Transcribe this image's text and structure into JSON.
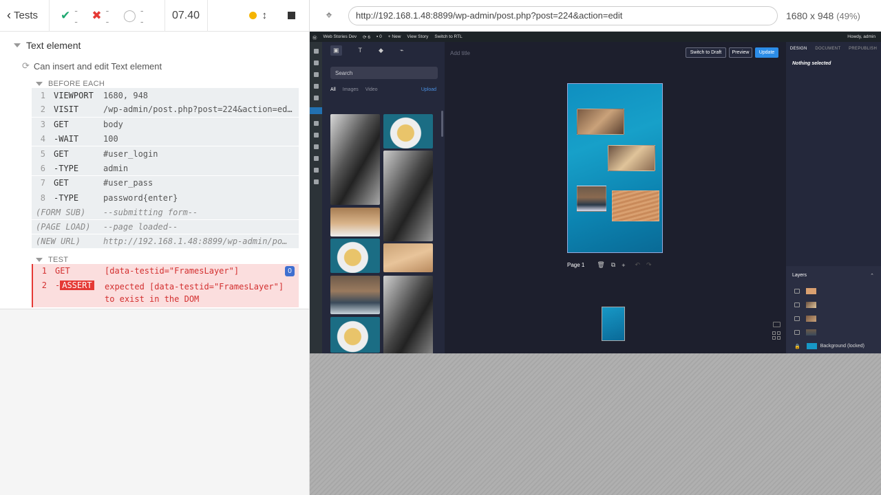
{
  "reporter": {
    "tests_label": "Tests",
    "passed": "--",
    "failed": "--",
    "pending": "--",
    "duration": "07.40",
    "suite_title": "Text element",
    "test_title": "Can insert and edit Text element",
    "before_each_label": "BEFORE EACH",
    "test_label": "TEST",
    "before_each": [
      {
        "num": "1",
        "name": "VIEWPORT",
        "msg": "1680, 948"
      },
      {
        "num": "2",
        "name": "VISIT",
        "msg": "/wp-admin/post.php?post=224&action=edit -> …"
      },
      {
        "num": "3",
        "name": "GET",
        "msg": "body"
      },
      {
        "num": "4",
        "name": "-WAIT",
        "msg": "100"
      },
      {
        "num": "5",
        "name": "GET",
        "msg": "#user_login"
      },
      {
        "num": "6",
        "name": "-TYPE",
        "msg": "admin"
      },
      {
        "num": "7",
        "name": "GET",
        "msg": "#user_pass"
      },
      {
        "num": "8",
        "name": "-TYPE",
        "msg": "password{enter}"
      }
    ],
    "events": [
      {
        "name": "(FORM SUB)",
        "msg": "--submitting form--"
      },
      {
        "name": "(PAGE LOAD)",
        "msg": "--page loaded--"
      },
      {
        "name": "(NEW URL)",
        "msg": "http://192.168.1.48:8899/wp-admin/po…"
      }
    ],
    "test_cmds": {
      "c1_num": "1",
      "c1_name": "GET",
      "c1_msg": "[data-testid=\"FramesLayer\"]",
      "c1_badge": "0",
      "c2_num": "2",
      "c2_name_prefix": "-",
      "c2_name": "ASSERT",
      "c2_msg_line1": "expected [data-testid=\"FramesLayer\"]",
      "c2_msg_line2": "to exist in the DOM"
    }
  },
  "aut": {
    "url": "http://192.168.1.48:8899/wp-admin/post.php?post=224&action=edit",
    "viewport_size": "1680 x 948",
    "viewport_scale": "(49%)"
  },
  "wp": {
    "site_name": "Web Stories Dev",
    "updates": "6",
    "comments": "0",
    "new_label": "+ New",
    "view_story": "View Story",
    "switch_rtl": "Switch to RTL",
    "howdy": "Howdy, admin",
    "search_placeholder": "Search",
    "filter_all": "All",
    "filter_images": "Images",
    "filter_video": "Video",
    "upload": "Upload",
    "add_title": "Add title",
    "switch_draft": "Switch to Draft",
    "preview": "Preview",
    "update": "Update",
    "page_label": "Page 1",
    "tab_design": "DESIGN",
    "tab_document": "DOCUMENT",
    "tab_prepublish": "PREPUBLISH",
    "nothing_selected": "Nothing selected",
    "layers_title": "Layers",
    "background_layer": "Background (locked)"
  },
  "colors": {
    "pass": "#1fa971",
    "fail": "#e53935",
    "running": "#f5b400",
    "accent_blue": "#2c8de8"
  }
}
